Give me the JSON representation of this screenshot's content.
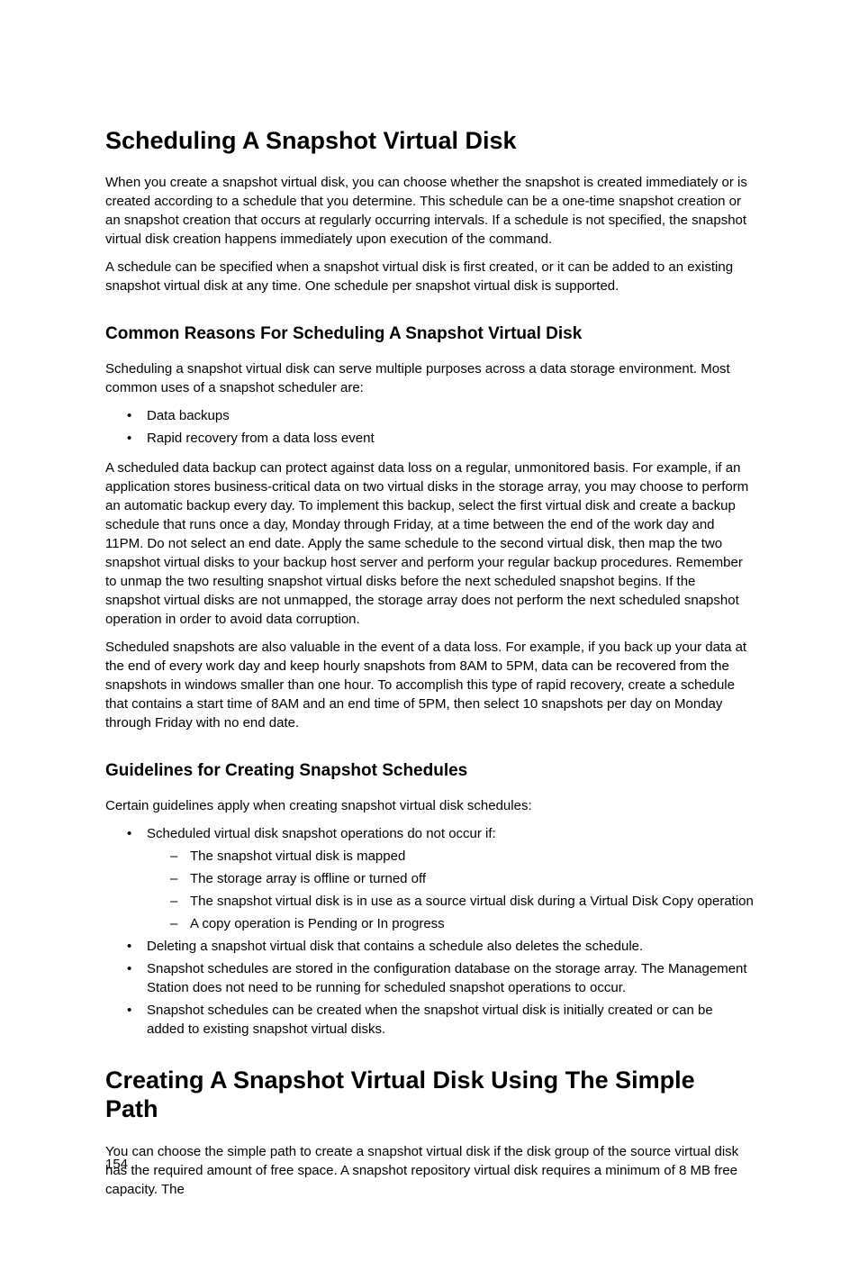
{
  "pageNumber": "154",
  "section1": {
    "title": "Scheduling A Snapshot Virtual Disk",
    "para1": "When you create a snapshot virtual disk, you can choose whether the snapshot is created immediately or is created according to a schedule that you determine. This schedule can be a one-time snapshot creation or an snapshot creation that occurs at regularly occurring intervals. If a schedule is not specified, the snapshot virtual disk creation happens immediately upon execution of the command.",
    "para2": "A schedule can be specified when a snapshot virtual disk is first created, or it can be added to an existing snapshot virtual disk at any time. One schedule per snapshot virtual disk is supported."
  },
  "section2": {
    "title": "Common Reasons For Scheduling A Snapshot Virtual Disk",
    "para1": "Scheduling a snapshot virtual disk can serve multiple purposes across a data storage environment. Most common uses of a snapshot scheduler are:",
    "bullets": [
      "Data backups",
      "Rapid recovery from a data loss event"
    ],
    "para2": "A scheduled data backup can protect against data loss on a regular, unmonitored basis. For example, if an application stores business-critical data on two virtual disks in the storage array, you may choose to perform an automatic backup every day. To implement this backup, select the first virtual disk and create a backup schedule that runs once a day, Monday through Friday, at a time between the end of the work day and 11PM. Do not select an end date. Apply the same schedule to the second virtual disk, then map the two snapshot virtual disks to your backup host server and perform your regular backup procedures. Remember to unmap the two resulting snapshot virtual disks before the next scheduled snapshot begins. If the snapshot virtual disks are not unmapped, the storage array does not perform the next scheduled snapshot operation in order to avoid data corruption.",
    "para3": "Scheduled snapshots are also valuable in the event of a data loss. For example, if you back up your data at the end of every work day and keep hourly snapshots from 8AM to 5PM, data can be recovered from the snapshots in windows smaller than one hour. To accomplish this type of rapid recovery, create a schedule that contains a start time of 8AM and an end time of 5PM, then select 10 snapshots per day on Monday through Friday with no end date."
  },
  "section3": {
    "title": "Guidelines for Creating Snapshot Schedules",
    "para1": "Certain guidelines apply when creating snapshot virtual disk schedules:",
    "bullet1": "Scheduled virtual disk snapshot operations do not occur if:",
    "dashes": [
      "The snapshot virtual disk is mapped",
      "The storage array is offline or turned off",
      "The snapshot virtual disk is in use as a source virtual disk during a Virtual Disk Copy operation",
      "A copy operation is Pending or In progress"
    ],
    "bullet2": "Deleting a snapshot virtual disk that contains a schedule also deletes the schedule.",
    "bullet3": "Snapshot schedules are stored in the configuration database on the storage array. The Management Station does not need to be running for scheduled snapshot operations to occur.",
    "bullet4": "Snapshot schedules can be created when the snapshot virtual disk is initially created or can be added to existing snapshot virtual disks."
  },
  "section4": {
    "title": "Creating A Snapshot Virtual Disk Using The Simple Path",
    "para1": "You can choose the simple path to create a snapshot virtual disk if the disk group of the source virtual disk has the required amount of free space. A snapshot repository virtual disk requires a minimum of 8 MB free capacity. The"
  }
}
